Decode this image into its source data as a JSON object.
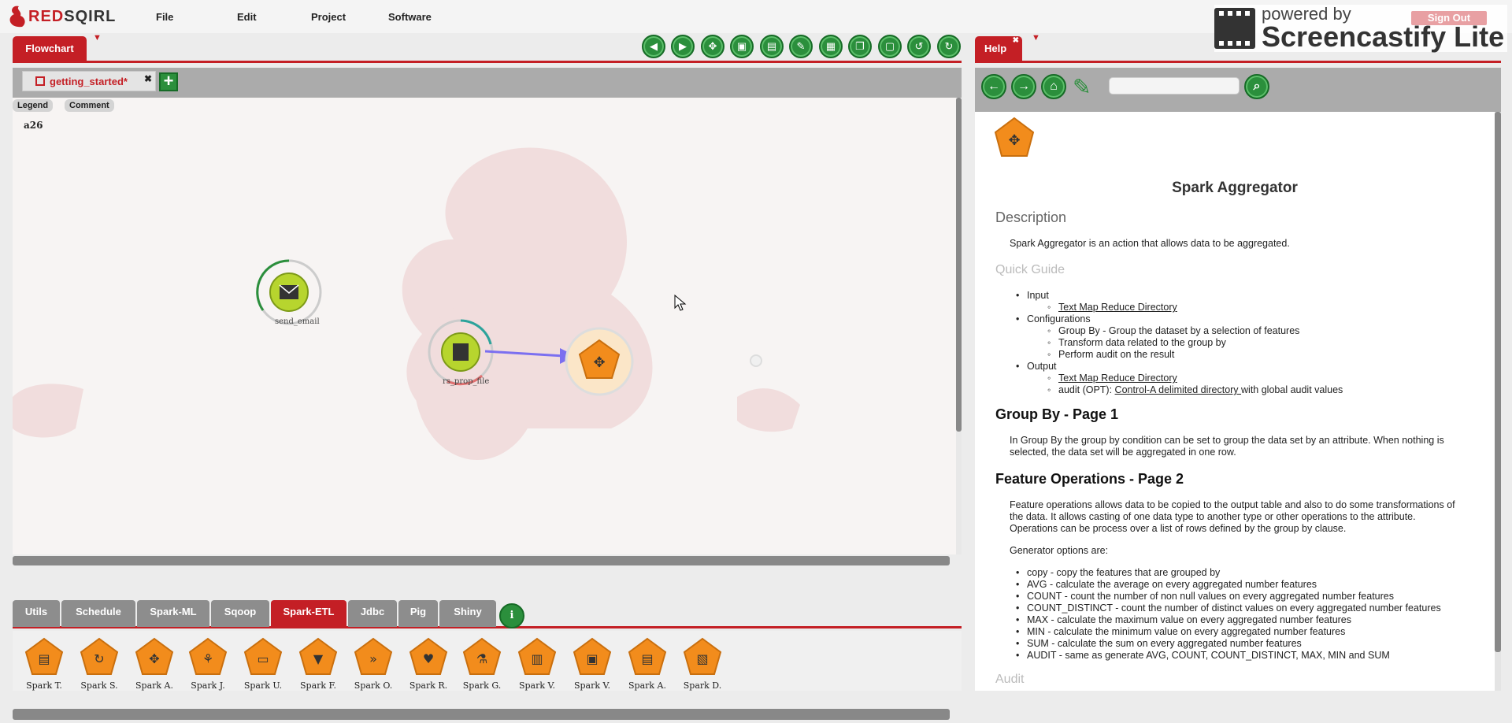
{
  "brand": {
    "logo_red": "RED",
    "logo_dark": "SQIRL"
  },
  "menu": [
    "File",
    "Edit",
    "Project",
    "Software"
  ],
  "watermark": {
    "line1": "powered by",
    "line2": "Screencastify Lite"
  },
  "signout": "Sign Out",
  "flowchart": {
    "tab_label": "Flowchart",
    "file_tab": "getting_started*",
    "legend_label": "Legend",
    "comment_label": "Comment",
    "canvas_text": "a26",
    "nodes": [
      {
        "label": "send_email"
      },
      {
        "label": "rs_prop_file"
      }
    ]
  },
  "palette": {
    "tabs": [
      "Utils",
      "Schedule",
      "Spark-ML",
      "Sqoop",
      "Spark-ETL",
      "Jdbc",
      "Pig",
      "Shiny"
    ],
    "active_tab": "Spark-ETL",
    "info": "i",
    "items": [
      "Spark T.",
      "Spark S.",
      "Spark A.",
      "Spark J.",
      "Spark U.",
      "Spark F.",
      "Spark O.",
      "Spark R.",
      "Spark G.",
      "Spark V.",
      "Spark V.",
      "Spark A.",
      "Spark D."
    ]
  },
  "help": {
    "tab_label": "Help",
    "title": "Spark Aggregator",
    "description_heading": "Description",
    "description": "Spark Aggregator is an action that allows data to be aggregated.",
    "quick_guide_heading": "Quick Guide",
    "input_label": "Input",
    "input_link": "Text Map Reduce Directory",
    "config_label": "Configurations",
    "config_items": [
      "Group By - Group the dataset by a selection of features",
      "Transform data related to the group by",
      "Perform audit on the result"
    ],
    "output_label": "Output",
    "output_link": "Text Map Reduce Directory",
    "audit_prefix": "audit (OPT): ",
    "audit_link": "Control-A delimited directory ",
    "audit_suffix": "with global audit values",
    "groupby_heading": "Group By - Page 1",
    "groupby_text": "In Group By the group by condition can be set to group the data set by an attribute. When nothing is selected, the data set will be aggregated in one row.",
    "features_heading": "Feature Operations - Page 2",
    "features_text": "Feature operations allows data to be copied to the output table and also to do some transformations of the data. It allows casting of one data type to another type or other operations to the attribute. Operations can be process over a list of rows defined by the group by clause.",
    "generator_text": "Generator options are:",
    "generator_items": [
      "copy - copy the features that are grouped by",
      "AVG - calculate the average on every aggregated number features",
      "COUNT - count the number of non null values on every aggregated number features",
      "COUNT_DISTINCT - count the number of distinct values on every aggregated number features",
      "MAX - calculate the maximum value on every aggregated number features",
      "MIN - calculate the minimum value on every aggregated number features",
      "SUM - calculate the sum on every aggregated number features",
      "AUDIT - same as generate AVG, COUNT, COUNT_DISTINCT, MAX, MIN and SUM"
    ],
    "audit_heading": "Audit"
  },
  "colors": {
    "brand_red": "#c41f25",
    "button_green": "#2b8f3c",
    "node_orange": "#f28c1c"
  }
}
